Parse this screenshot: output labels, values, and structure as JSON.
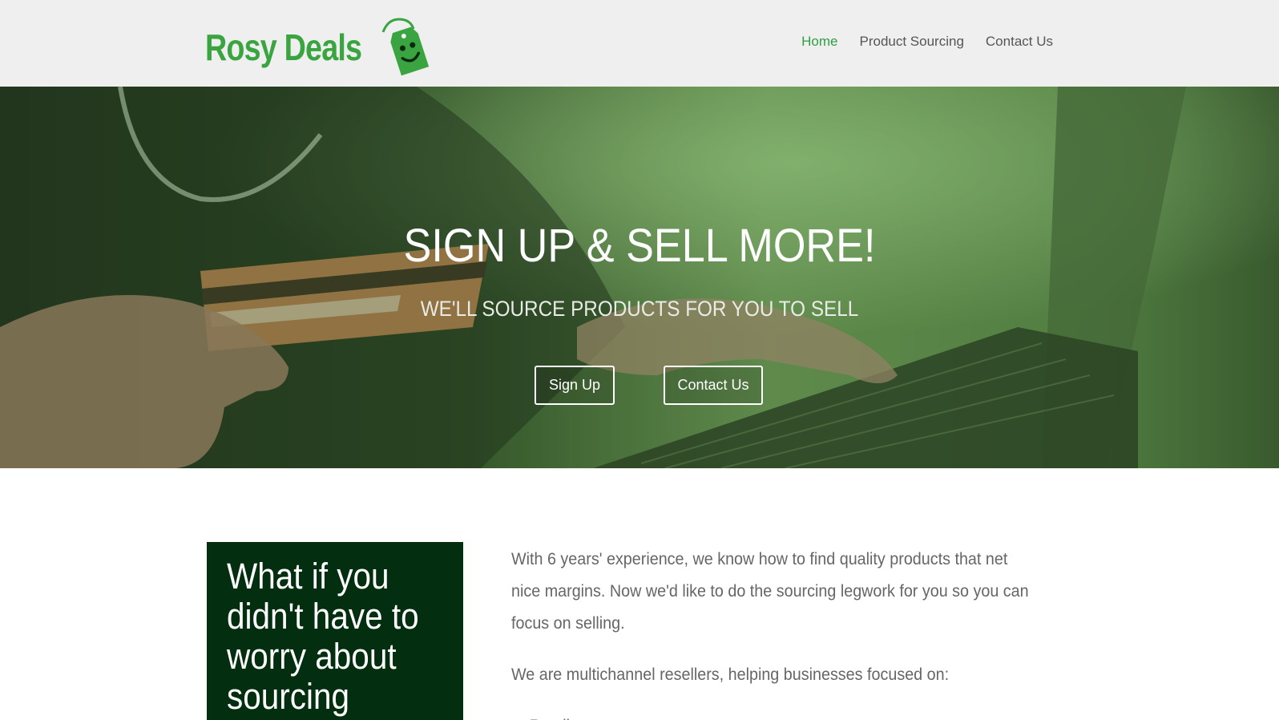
{
  "header": {
    "logo_text": "Rosy Deals",
    "nav": [
      {
        "label": "Home",
        "active": true
      },
      {
        "label": "Product Sourcing",
        "active": false
      },
      {
        "label": "Contact Us",
        "active": false
      }
    ]
  },
  "hero": {
    "title": "SIGN UP & SELL MORE!",
    "subtitle": "WE'LL SOURCE PRODUCTS FOR YOU TO SELL",
    "signup_label": "Sign Up",
    "contact_label": "Contact Us"
  },
  "content": {
    "callout": "What if you didn't have to worry about sourcing",
    "paragraph1": "With 6 years' experience, we know how to find quality products that net nice margins. Now we'd like to do the sourcing legwork for you so you can focus on selling.",
    "paragraph2": "We are multichannel resellers, helping businesses focused on:",
    "list": [
      "Retail"
    ]
  },
  "colors": {
    "brand_green": "#3aa540",
    "nav_active": "#2ea043",
    "callout_bg": "#032e10"
  },
  "icons": [
    "price-tag-smiley-icon"
  ]
}
